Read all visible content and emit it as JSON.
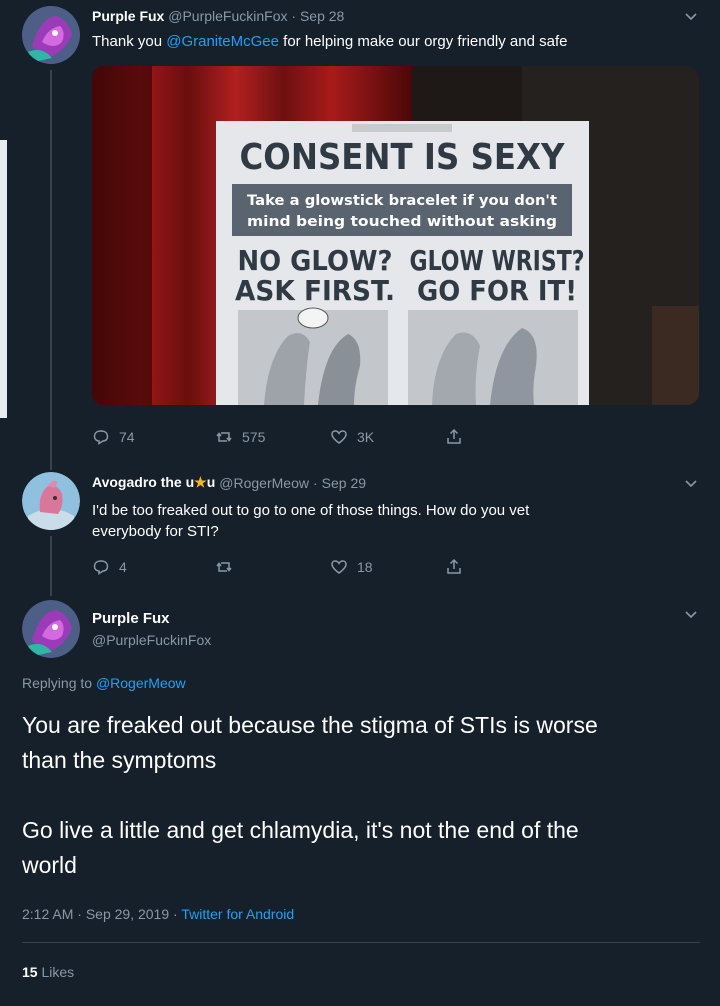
{
  "tweet1": {
    "name": "Purple Fux",
    "handle": "@PurpleFuckinFox",
    "separator": "·",
    "date": "Sep 28",
    "text_pre": "Thank you ",
    "mention": "@GraniteMcGee",
    "text_post": " for helping make our orgy friendly and safe",
    "image": {
      "sign_title": "CONSENT IS SEXY",
      "sign_sub1": "Take a glowstick bracelet if you don't",
      "sign_sub2": "mind being touched without asking",
      "left_line1": "NO GLOW?",
      "left_line2": "ASK FIRST.",
      "right_line1": "GLOW WRIST?",
      "right_line2": "GO FOR IT!"
    },
    "replies": "74",
    "retweets": "575",
    "likes": "3K"
  },
  "tweet2": {
    "name_pre": "Avogadro the u",
    "name_post": "u",
    "handle": "@RogerMeow",
    "separator": "·",
    "date": "Sep 29",
    "text_line1": "I'd be too freaked out to go to one of those things. How do you vet",
    "text_line2": "everybody for STI?",
    "replies": "4",
    "likes": "18"
  },
  "tweet3": {
    "name": "Purple Fux",
    "handle": "@PurpleFuckinFox",
    "replying_label": "Replying to ",
    "replying_mention": "@RogerMeow",
    "para1_line1": "You are freaked out because the stigma of STIs is worse",
    "para1_line2": "than the symptoms",
    "para2_line1": "Go live a little and get chlamydia, it's not the end of the",
    "para2_line2": "world",
    "time": "2:12 AM",
    "separator": "·",
    "date": "Sep 29, 2019",
    "source": "Twitter for Android",
    "likes_count": "15",
    "likes_label": "Likes"
  },
  "colors": {
    "background": "#15202b",
    "muted": "#8899a6",
    "link": "#1da1f2",
    "divider": "#38444d"
  }
}
